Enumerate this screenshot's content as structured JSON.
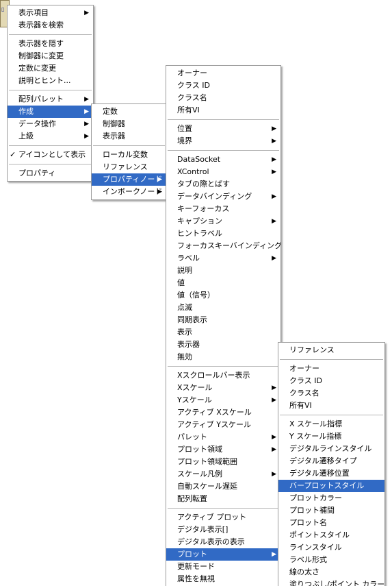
{
  "menus": {
    "main": [
      {
        "label": "表示項目",
        "submenu": true
      },
      {
        "label": "表示器を検索"
      },
      {
        "sep": true
      },
      {
        "label": "表示器を隠す"
      },
      {
        "label": "制御器に変更"
      },
      {
        "label": "定数に変更"
      },
      {
        "label": "説明とヒント..."
      },
      {
        "sep": true
      },
      {
        "label": "配列パレット",
        "submenu": true
      },
      {
        "label": "作成",
        "submenu": true,
        "highlighted": true
      },
      {
        "label": "データ操作",
        "submenu": true
      },
      {
        "label": "上級",
        "submenu": true
      },
      {
        "sep": true
      },
      {
        "label": "アイコンとして表示",
        "checked": true
      },
      {
        "sep": true
      },
      {
        "label": "プロパティ"
      }
    ],
    "create": [
      {
        "label": "定数"
      },
      {
        "label": "制御器"
      },
      {
        "label": "表示器"
      },
      {
        "sep": true
      },
      {
        "label": "ローカル変数"
      },
      {
        "label": "リファレンス"
      },
      {
        "label": "プロパティノード",
        "submenu": true,
        "highlighted": true
      },
      {
        "label": "インボークノード",
        "submenu": true
      }
    ],
    "property_node": [
      {
        "label": "オーナー"
      },
      {
        "label": "クラス ID"
      },
      {
        "label": "クラス名"
      },
      {
        "label": "所有VI"
      },
      {
        "sep": true
      },
      {
        "label": "位置",
        "submenu": true
      },
      {
        "label": "境界",
        "submenu": true
      },
      {
        "sep": true
      },
      {
        "label": "DataSocket",
        "submenu": true
      },
      {
        "label": "XControl",
        "submenu": true
      },
      {
        "label": "タブの際とばす"
      },
      {
        "label": "データバインディング",
        "submenu": true
      },
      {
        "label": "キーフォーカス"
      },
      {
        "label": "キャプション",
        "submenu": true
      },
      {
        "label": "ヒントラベル"
      },
      {
        "label": "フォーカスキーバインディング"
      },
      {
        "label": "ラベル",
        "submenu": true
      },
      {
        "label": "説明"
      },
      {
        "label": "値"
      },
      {
        "label": "値（信号）"
      },
      {
        "label": "点滅"
      },
      {
        "label": "同期表示"
      },
      {
        "label": "表示"
      },
      {
        "label": "表示器"
      },
      {
        "label": "無効"
      },
      {
        "sep": true
      },
      {
        "label": "Xスクロールバー表示"
      },
      {
        "label": "Xスケール",
        "submenu": true
      },
      {
        "label": "Yスケール",
        "submenu": true
      },
      {
        "label": "アクティブ Xスケール"
      },
      {
        "label": "アクティブ Yスケール"
      },
      {
        "label": "パレット",
        "submenu": true
      },
      {
        "label": "プロット領域",
        "submenu": true
      },
      {
        "label": "プロット領域範囲"
      },
      {
        "label": "スケール凡例",
        "submenu": true
      },
      {
        "label": "自動スケール遅延"
      },
      {
        "label": "配列転置"
      },
      {
        "sep": true
      },
      {
        "label": "アクティブ プロット"
      },
      {
        "label": "デジタル表示[]"
      },
      {
        "label": "デジタル表示の表示"
      },
      {
        "label": "プロット",
        "submenu": true,
        "highlighted": true
      },
      {
        "label": "更新モード"
      },
      {
        "label": "属性を無視"
      }
    ],
    "plot": [
      {
        "label": "リファレンス"
      },
      {
        "sep": true
      },
      {
        "label": "オーナー"
      },
      {
        "label": "クラス ID"
      },
      {
        "label": "クラス名"
      },
      {
        "label": "所有VI"
      },
      {
        "sep": true
      },
      {
        "label": "X スケール指標"
      },
      {
        "label": "Y スケール指標"
      },
      {
        "label": "デジタルラインスタイル"
      },
      {
        "label": "デジタル遷移タイプ"
      },
      {
        "label": "デジタル遷移位置"
      },
      {
        "label": "バープロットスタイル",
        "highlighted": true
      },
      {
        "label": "プロットカラー"
      },
      {
        "label": "プロット補間"
      },
      {
        "label": "プロット名"
      },
      {
        "label": "ポイントスタイル"
      },
      {
        "label": "ラインスタイル"
      },
      {
        "label": "ラベル形式"
      },
      {
        "label": "線の太さ"
      },
      {
        "label": "塗りつぶし/ポイント カラー"
      }
    ]
  },
  "colors": {
    "highlight": "#316ac5",
    "highlight_text": "#ffffff"
  }
}
